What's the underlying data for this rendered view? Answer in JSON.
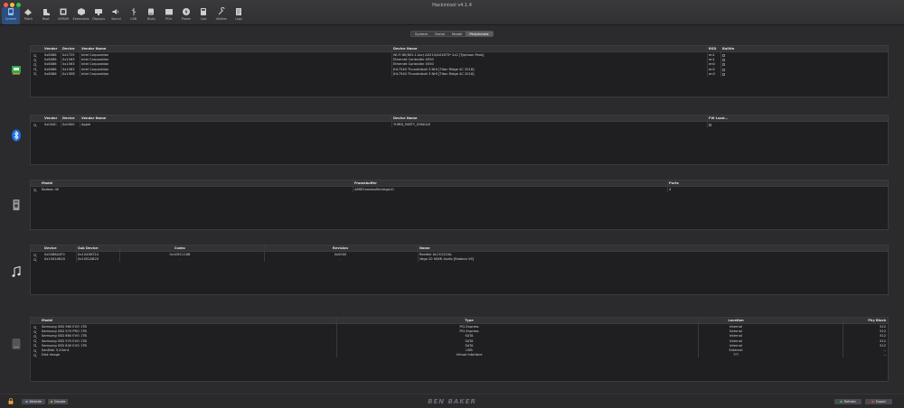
{
  "window": {
    "title": "Hackintool v4.1.4"
  },
  "toolbar": [
    {
      "name": "System",
      "icon": "system-icon"
    },
    {
      "name": "Patch",
      "icon": "patch-icon"
    },
    {
      "name": "Boot",
      "icon": "boot-icon"
    },
    {
      "name": "NVRAM",
      "icon": "nvram-icon"
    },
    {
      "name": "Extensions",
      "icon": "extensions-icon"
    },
    {
      "name": "Displays",
      "icon": "displays-icon"
    },
    {
      "name": "Sound",
      "icon": "sound-icon"
    },
    {
      "name": "USB",
      "icon": "usb-icon"
    },
    {
      "name": "Disks",
      "icon": "disks-icon"
    },
    {
      "name": "PCIe",
      "icon": "pcie-icon"
    },
    {
      "name": "Power",
      "icon": "power-icon"
    },
    {
      "name": "Calc",
      "icon": "calc-icon"
    },
    {
      "name": "Utilities",
      "icon": "utilities-icon"
    },
    {
      "name": "Logs",
      "icon": "logs-icon"
    }
  ],
  "tabs": [
    "System",
    "Serial",
    "Model",
    "Peripherals"
  ],
  "active_tab": "Peripherals",
  "network": {
    "headers": [
      "Vendor",
      "Device",
      "Vendor Name",
      "Device Name",
      "BSD",
      "Builtin"
    ],
    "rows": [
      [
        "0x8086",
        "0x2725",
        "Intel Corporation",
        "Wi-Fi 6E(802.11ax) AX210/AX1675* 2x2 [Typhoon Peak]",
        "en1"
      ],
      [
        "0x8086",
        "0x1563",
        "Intel Corporation",
        "Ethernet Controller X550",
        "en1"
      ],
      [
        "0x8086",
        "0x1563",
        "Intel Corporation",
        "Ethernet Controller X550",
        "en0"
      ],
      [
        "0x8086",
        "0x1563",
        "Intel Corporation",
        "JHL7540 Thunderbolt 3 NHI [Titan Ridge 4C 2018]",
        "en2"
      ],
      [
        "0x8086",
        "0x15EB",
        "Intel Corporation",
        "JHL7540 Thunderbolt 3 NHI [Titan Ridge 4C 2018]",
        "en3"
      ]
    ]
  },
  "bluetooth": {
    "headers": [
      "Vendor",
      "Device",
      "Vendor Name",
      "Device Name",
      "FW Load..."
    ],
    "rows": [
      [
        "0x004C",
        "0x0000",
        "Apple",
        "THIRD_PARTY_DONGLE"
      ]
    ]
  },
  "graphics": {
    "headers": [
      "Model",
      "Framebuffer",
      "Ports"
    ],
    "rows": [
      [
        "Radeon VII",
        "AMDFramebufferVega10",
        "4"
      ]
    ]
  },
  "audio": {
    "headers": [
      "Device",
      "Sub Device",
      "Codec",
      "Revision",
      "Name"
    ],
    "rows": [
      [
        "0x0086A2F0",
        "0x1043B724",
        "0x10EC1168",
        "0x0000",
        "Realtek ALCS1220A"
      ],
      [
        "0x1002AB20",
        "0x1002AB20",
        "-",
        "-",
        "Vega 20 HDMI Audio [Radeon VII]"
      ]
    ]
  },
  "storage": {
    "headers": [
      "Model",
      "Type",
      "Location",
      "Phy Block"
    ],
    "rows": [
      [
        "Samsung SSD 960 EVO 1TB",
        "PCI-Express",
        "Internal",
        "512"
      ],
      [
        "Samsung SSD 970 PRO 1TB",
        "PCI-Express",
        "Internal",
        "512"
      ],
      [
        "Samsung SSD 860 EVO 1TB",
        "SATA",
        "Internal",
        "512"
      ],
      [
        "Samsung SSD 970 EVO 1TB",
        "SATA",
        "Internal",
        "512"
      ],
      [
        "Samsung SSD 840 EVO 1TB",
        "SATA",
        "Internal",
        "512"
      ],
      [
        "SanDisk 3.2Gen1",
        "USB",
        "External",
        "--"
      ],
      [
        "Disk Image",
        "Virtual Interface",
        "???",
        "--"
      ]
    ]
  },
  "bottom": {
    "website_label": "Website",
    "donate_label": "Donate",
    "brand": "BEN BAKER",
    "refresh_label": "Refresh",
    "export_label": "Export"
  },
  "colors": {
    "accent": "#2c4f7d",
    "accent_text": "#8fc0ff",
    "section_bg": "#1f1f22"
  }
}
